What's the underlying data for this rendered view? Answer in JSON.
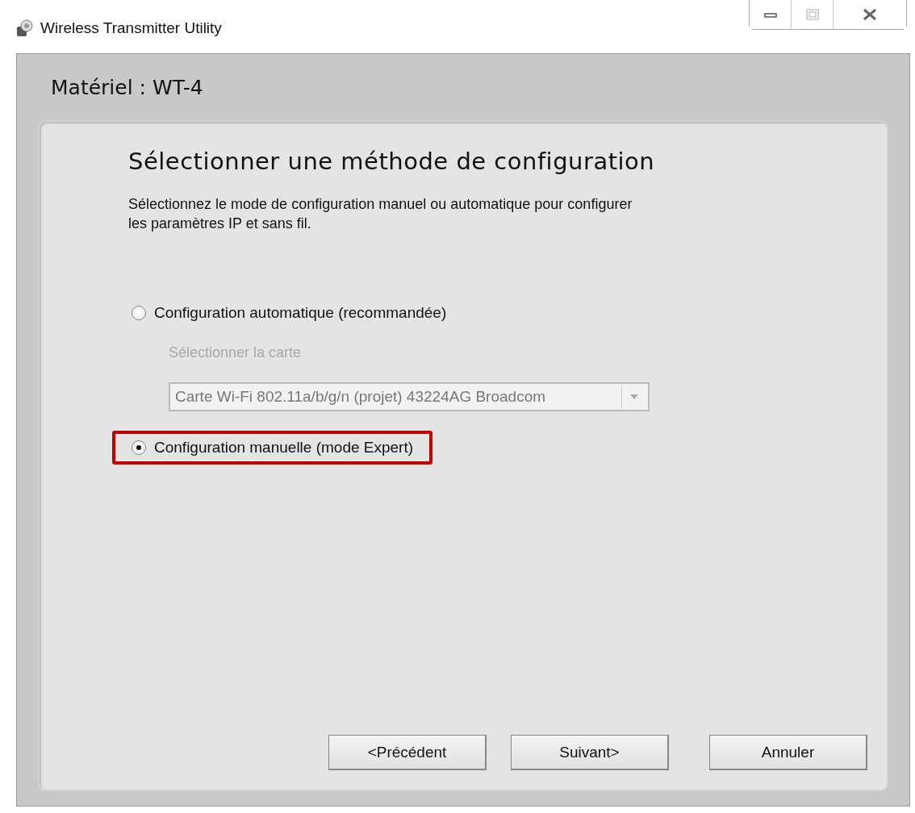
{
  "window": {
    "title": "Wireless Transmitter Utility"
  },
  "device_header": "Matériel : WT-4",
  "heading": "Sélectionner une méthode de configuration",
  "description": "Sélectionnez le mode de configuration manuel ou automatique pour configurer les paramètres IP et sans fil.",
  "options": [
    {
      "label": "Configuration automatique (recommandée)",
      "selected": false,
      "highlighted": false,
      "card_select": {
        "label": "Sélectionner la carte",
        "value": "Carte Wi-Fi 802.11a/b/g/n (projet) 43224AG Broadcom",
        "disabled": true
      }
    },
    {
      "label": "Configuration manuelle (mode Expert)",
      "selected": true,
      "highlighted": true
    }
  ],
  "buttons": [
    {
      "label": "<Précédent"
    },
    {
      "label": "Suivant>"
    },
    {
      "label": "Annuler"
    }
  ]
}
